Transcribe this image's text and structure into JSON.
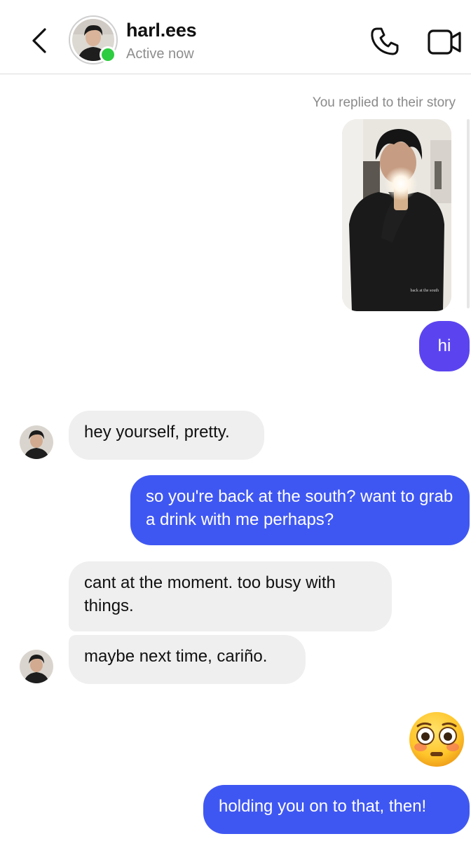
{
  "header": {
    "username": "harl.ees",
    "status": "Active now",
    "icons": {
      "back": "chevron-left-icon",
      "call": "phone-icon",
      "video": "video-camera-icon"
    },
    "online_color": "#2ecc40"
  },
  "thread": {
    "story_reply_caption": "You replied to their story",
    "story_overlay_text": "back at the south",
    "messages": [
      {
        "from": "me",
        "text": "hi"
      },
      {
        "from": "them",
        "text": "hey yourself, pretty."
      },
      {
        "from": "me",
        "text": "so you're back at the south? want to grab a drink with me perhaps?"
      },
      {
        "from": "them",
        "text": "cant at the moment. too busy with things."
      },
      {
        "from": "them",
        "text": "maybe next time, cariño."
      },
      {
        "from": "me",
        "emoji": "flushed-face-icon"
      },
      {
        "from": "me",
        "text": "holding you on to that, then!"
      }
    ]
  },
  "colors": {
    "outgoing_bubble": "#3f57f2",
    "incoming_bubble": "#efefef",
    "first_outgoing_bubble": "#5b44f0"
  }
}
